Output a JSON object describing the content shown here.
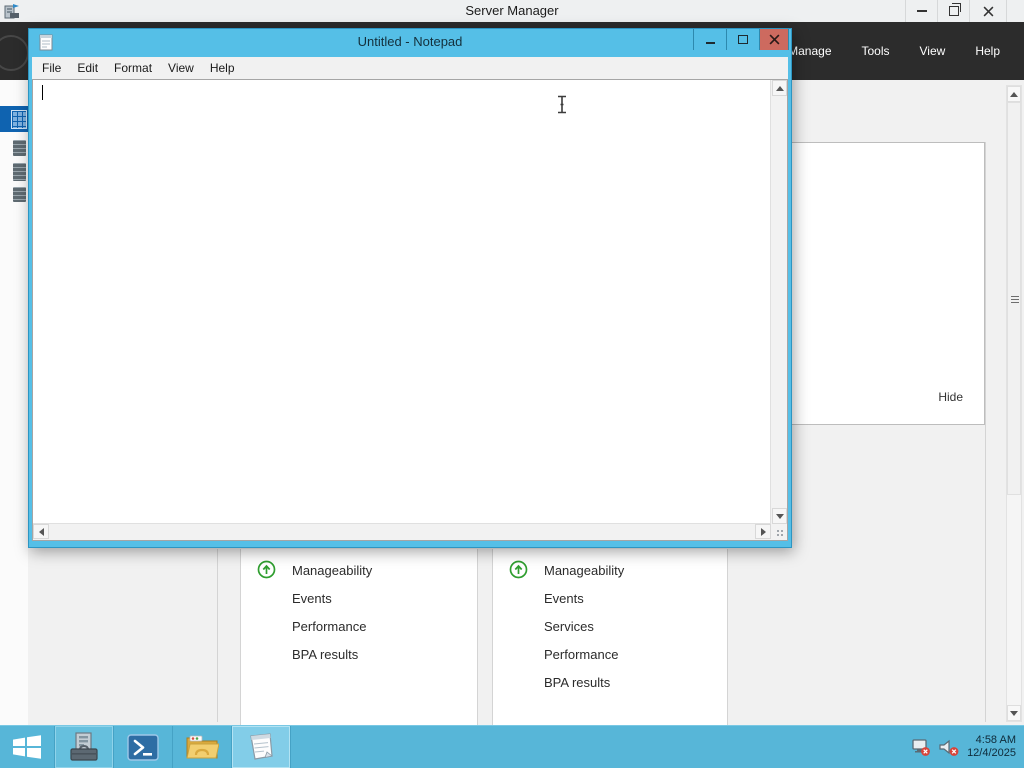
{
  "server_manager": {
    "window_title": "Server Manager",
    "menus": [
      "Manage",
      "Tools",
      "View",
      "Help"
    ],
    "hide_label": "Hide",
    "tiles": [
      {
        "rows": [
          "Manageability",
          "Events",
          "Performance",
          "BPA results"
        ]
      },
      {
        "rows": [
          "Manageability",
          "Events",
          "Services",
          "Performance",
          "BPA results"
        ]
      }
    ]
  },
  "notepad": {
    "window_title": "Untitled - Notepad",
    "menus": [
      "File",
      "Edit",
      "Format",
      "View",
      "Help"
    ],
    "content": ""
  },
  "taskbar": {
    "clock_time": "4:58 AM",
    "clock_date": "12/4/2025"
  },
  "colors": {
    "accent_cyan": "#55bfe7",
    "taskbar_cyan": "#57b6d8",
    "close_red": "#cd6a5f",
    "selected_blue": "#0f63b0",
    "status_green": "#2f9e2f",
    "dark_bar": "#2c2c2c"
  }
}
